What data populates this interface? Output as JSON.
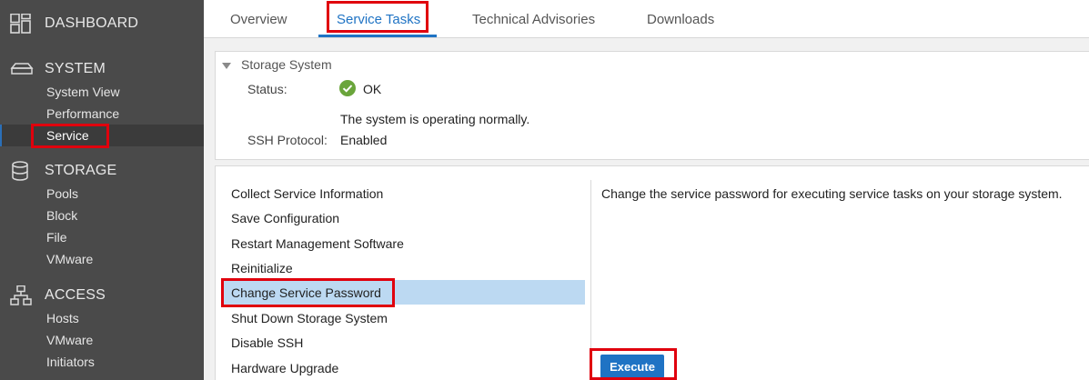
{
  "sidebar": {
    "dashboard": "DASHBOARD",
    "system": {
      "title": "SYSTEM",
      "items": [
        "System View",
        "Performance",
        "Service"
      ]
    },
    "storage": {
      "title": "STORAGE",
      "items": [
        "Pools",
        "Block",
        "File",
        "VMware"
      ]
    },
    "access": {
      "title": "ACCESS",
      "items": [
        "Hosts",
        "VMware",
        "Initiators"
      ]
    },
    "active_item": "Service"
  },
  "tabs": {
    "items": [
      "Overview",
      "Service Tasks",
      "Technical Advisories",
      "Downloads"
    ],
    "active": "Service Tasks"
  },
  "storage_system": {
    "title": "Storage System",
    "status_label": "Status:",
    "status_value": "OK",
    "status_description": "The system is operating normally.",
    "ssh_label": "SSH Protocol:",
    "ssh_value": "Enabled"
  },
  "service_tasks": {
    "items": [
      "Collect Service Information",
      "Save Configuration",
      "Restart Management Software",
      "Reinitialize",
      "Change Service Password",
      "Shut Down Storage System",
      "Disable SSH",
      "Hardware Upgrade"
    ],
    "selected": "Change Service Password",
    "description": "Change the service password for executing service tasks on your storage system.",
    "execute_label": "Execute"
  },
  "colors": {
    "sidebar_bg": "#4a4a4a",
    "accent": "#1f73c4",
    "selection": "#bcd9f2",
    "ok_green": "#6aa53b",
    "highlight_red": "#e0000d"
  }
}
